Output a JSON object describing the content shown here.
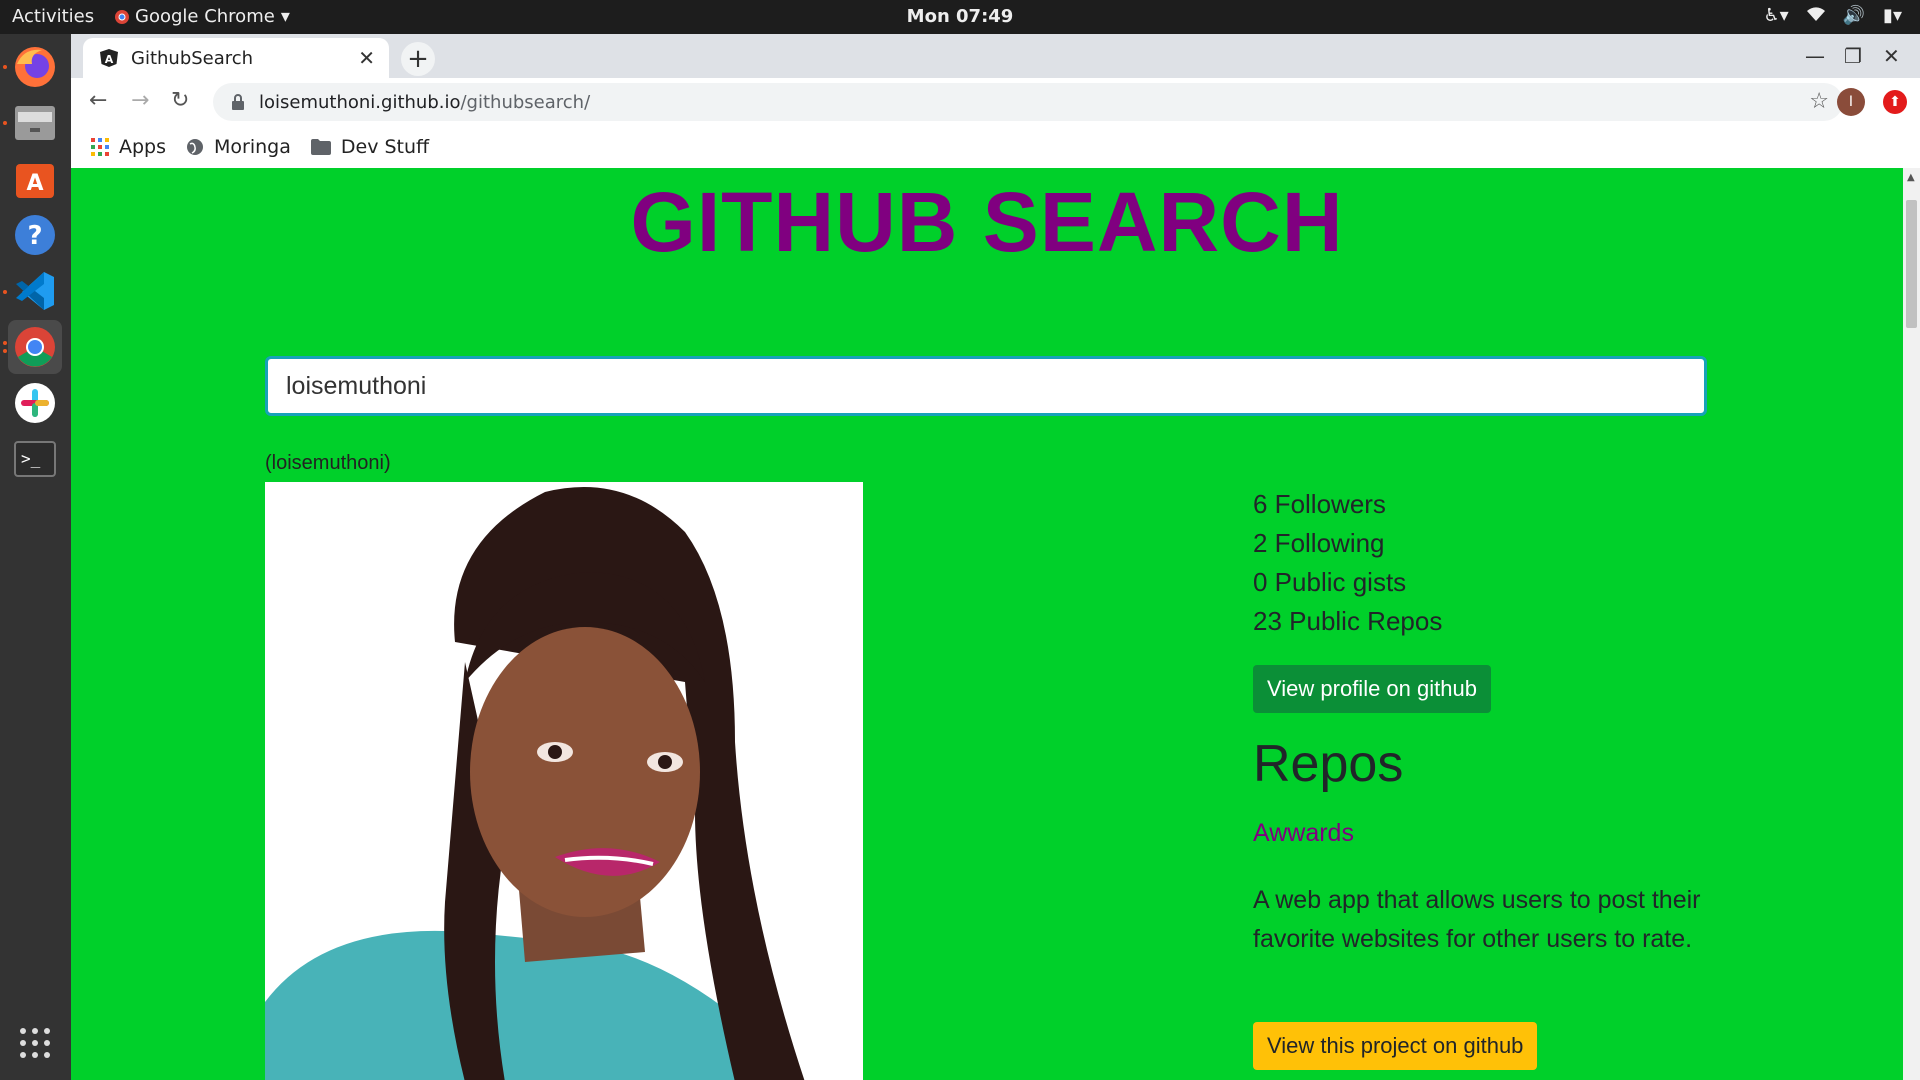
{
  "system_bar": {
    "activities": "Activities",
    "app_name": "Google Chrome",
    "clock": "Mon 07:49"
  },
  "dock": {
    "items": [
      "firefox-icon",
      "files-icon",
      "software-center-icon",
      "help-icon",
      "vscode-icon",
      "chrome-icon",
      "slack-icon",
      "terminal-icon",
      "app-grid-icon"
    ]
  },
  "browser": {
    "tab_title": "GithubSearch",
    "url_host": "loisemuthoni.github.io",
    "url_path": "/githubsearch/",
    "profile_initial": "I",
    "bookmarks": [
      "Apps",
      "Moringa",
      "Dev Stuff"
    ]
  },
  "page": {
    "title": "GITHUB SEARCH",
    "search_value": "loisemuthoni",
    "username": "(loisemuthoni)",
    "stats": {
      "followers": "6 Followers",
      "following": "2 Following",
      "gists": "0 Public gists",
      "repos": "23 Public Repos"
    },
    "profile_button": "View profile on github",
    "repos_heading": "Repos",
    "repo": {
      "name": "Awwards",
      "description": "A web app that allows users to post their favorite websites for other users to rate.",
      "button": "View this project on github"
    }
  },
  "colors": {
    "page_bg": "#00d02a",
    "title": "#800080",
    "profile_btn": "#0b8f37",
    "project_btn": "#ffc107"
  }
}
